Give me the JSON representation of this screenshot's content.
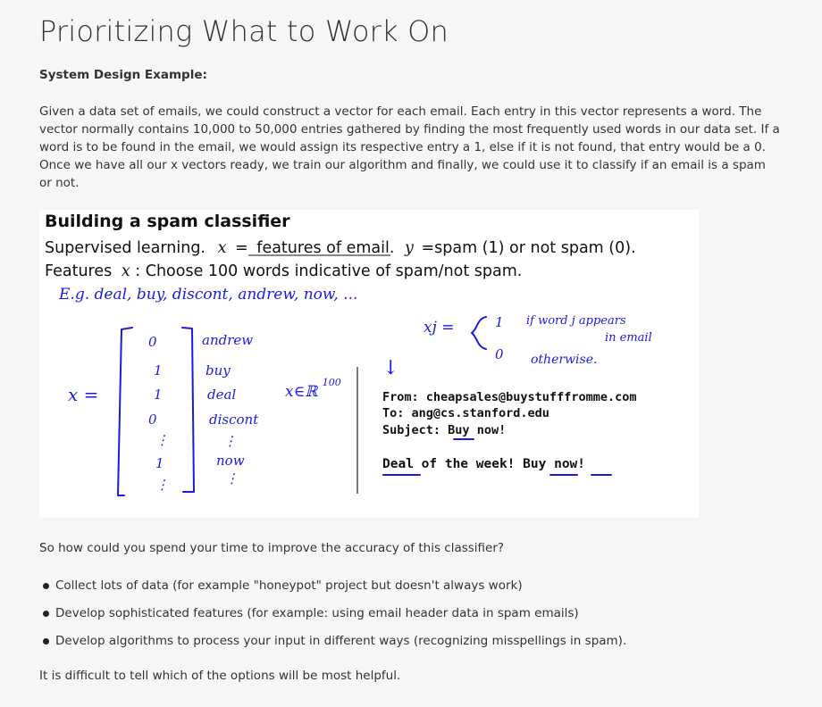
{
  "page": {
    "title": "Prioritizing What to Work On",
    "subheading": "System Design Example:",
    "intro": "Given a data set of emails, we could construct a vector for each email. Each entry in this vector represents a word. The vector normally contains 10,000 to 50,000 entries gathered by finding the most frequently used words in our data set. If a word is to be found in the email, we would assign its respective entry a 1, else if it is not found, that entry would be a 0. Once we have all our x vectors ready, we train our algorithm and finally, we could use it to classify if an email is a spam or not.",
    "question": "So how could you spend your time to improve the accuracy of this classifier?",
    "bullets": [
      "Collect lots of data (for example \"honeypot\" project but doesn't always work)",
      "Develop sophisticated features (for example: using email header data in spam emails)",
      "Develop algorithms to process your input in different ways (recognizing misspellings in spam)."
    ],
    "conclusion": "It is difficult to tell which of the options will be most helpful."
  },
  "slide": {
    "heading": "Building a spam classifier",
    "line1": {
      "prefix": "Supervised learning.",
      "x_var": "x",
      "eq": "=",
      "x_def": "features of email.",
      "y_var": "y",
      "y_def": "=spam (1) or not spam (0)."
    },
    "line2": {
      "prefix": "Features",
      "x_var": "x",
      "rest": ": Choose 100 words indicative of spam/not spam."
    },
    "handwriting": {
      "example_list": "E.g. deal, buy, discont, andrew, now, ...",
      "x_label": "x =",
      "vector_values": [
        "0",
        "1",
        "1",
        "0",
        "⋮",
        "1",
        "⋮"
      ],
      "vector_words": [
        "andrew",
        "buy",
        "deal",
        "discont",
        "⋮",
        "now",
        "⋮"
      ],
      "dimension": "x∈ℝ",
      "dimension_exp": "100",
      "xj_def": "xj =",
      "case_one_value": "1",
      "case_one_text": "if word j appears",
      "case_one_text2": "in email",
      "case_zero_value": "0",
      "case_zero_text": "otherwise.",
      "arrow": "↓"
    },
    "email": {
      "from": "From: cheapsales@buystufffromme.com",
      "to": "To: ang@cs.stanford.edu",
      "subject_label": "Subject:",
      "subject_buy": "Buy",
      "subject_now": "now!",
      "body_deal": "Deal",
      "body_mid": "of the week!",
      "body_buy": "Buy",
      "body_now": "now!"
    }
  }
}
